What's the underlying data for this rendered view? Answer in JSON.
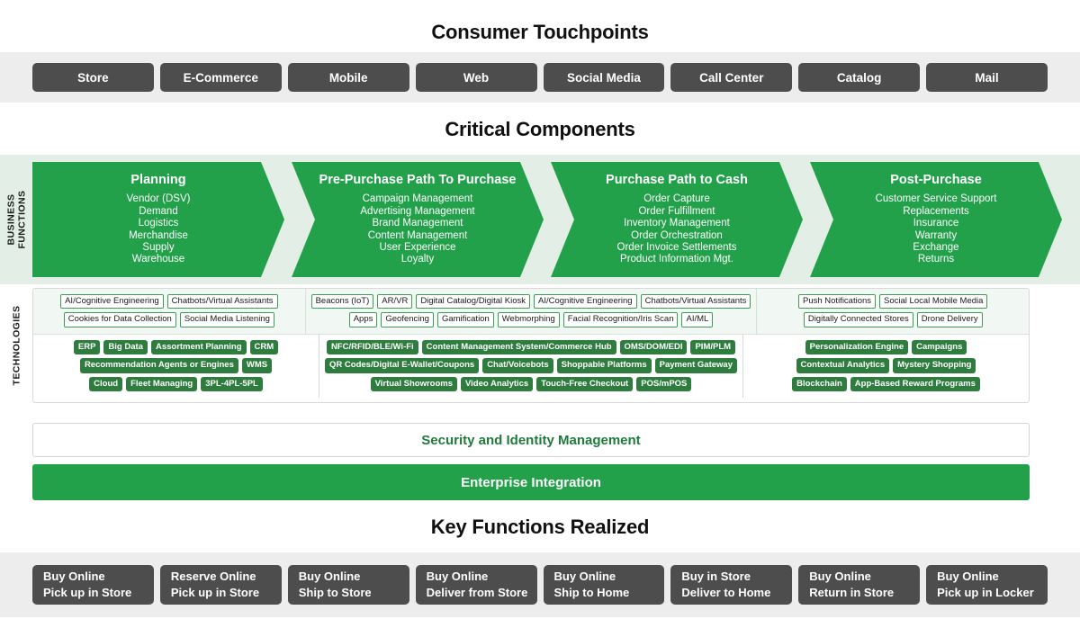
{
  "consumer_touchpoints": {
    "title": "Consumer Touchpoints",
    "items": [
      "Store",
      "E-Commerce",
      "Mobile",
      "Web",
      "Social Media",
      "Call Center",
      "Catalog",
      "Mail"
    ]
  },
  "critical_components": {
    "title": "Critical Components",
    "business_functions_label": "BUSINESS\nFUNCTIONS",
    "business_functions_label_line1": "BUSINESS",
    "business_functions_label_line2": "FUNCTIONS",
    "technologies_label": "TECHNOLOGIES",
    "stages": [
      {
        "title": "Planning",
        "items": [
          "Vendor (DSV)",
          "Demand",
          "Logistics",
          "Merchandise",
          "Supply",
          "Warehouse"
        ],
        "items_text": "Vendor (DSV)\nDemand\nLogistics\nMerchandise\nSupply\nWarehouse"
      },
      {
        "title": "Pre-Purchase Path To Purchase",
        "items": [
          "Campaign Management",
          "Advertising Management",
          "Brand Management",
          "Content Management",
          "User Experience",
          "Loyalty"
        ],
        "items_text": "Campaign Management\nAdvertising Management\nBrand Management\nContent Management\nUser Experience\nLoyalty"
      },
      {
        "title": "Purchase Path to Cash",
        "items": [
          "Order Capture",
          "Order Fulfillment",
          "Inventory Management",
          "Order Orchestration",
          "Order Invoice Settlements",
          "Product Information Mgt."
        ],
        "items_text": "Order Capture\nOrder Fulfillment\nInventory Management\nOrder Orchestration\nOrder Invoice Settlements\nProduct Information Mgt."
      },
      {
        "title": "Post-Purchase",
        "items": [
          "Customer Service Support",
          "Replacements",
          "Insurance",
          "Warranty",
          "Exchange",
          "Returns"
        ],
        "items_text": "Customer Service Support\nReplacements\nInsurance\nWarranty\nExchange\nReturns"
      }
    ],
    "technologies": {
      "outlined_columns": [
        {
          "lines": [
            [
              "AI/Cognitive Engineering",
              "Chatbots/Virtual Assistants"
            ],
            [
              "Cookies for Data Collection",
              "Social Media Listening"
            ]
          ]
        },
        {
          "lines": [
            [
              "Beacons (IoT)",
              "AR/VR",
              "Digital Catalog/Digital Kiosk",
              "AI/Cognitive Engineering",
              "Chatbots/Virtual Assistants"
            ],
            [
              "Apps",
              "Geofencing",
              "Gamification",
              "Webmorphing",
              "Facial Recognition/Iris Scan",
              "AI/ML"
            ]
          ]
        },
        {
          "lines": [
            [
              "Push Notifications",
              "Social Local Mobile Media"
            ],
            [
              "Digitally Connected Stores",
              "Drone Delivery"
            ]
          ]
        }
      ],
      "solid_columns": [
        {
          "lines": [
            [
              "ERP",
              "Big Data",
              "Assortment Planning",
              "CRM"
            ],
            [
              "Recommendation Agents or Engines",
              "WMS"
            ],
            [
              "Cloud",
              "Fleet Managing",
              "3PL-4PL-5PL"
            ]
          ]
        },
        {
          "lines": [
            [
              "NFC/RFID/BLE/Wi-Fi",
              "Content Management System/Commerce Hub",
              "OMS/DOM/EDI",
              "PIM/PLM"
            ],
            [
              "QR Codes/Digital E-Wallet/Coupons",
              "Chat/Voicebots",
              "Shoppable Platforms",
              "Payment Gateway"
            ],
            [
              "Virtual Showrooms",
              "Video Analytics",
              "Touch-Free Checkout",
              "POS/mPOS"
            ]
          ]
        },
        {
          "lines": [
            [
              "Personalization Engine",
              "Campaigns"
            ],
            [
              "Contextual Analytics",
              "Mystery Shopping"
            ],
            [
              "Blockchain",
              "App-Based Reward Programs"
            ]
          ]
        }
      ]
    },
    "security_bar": "Security and Identity Management",
    "enterprise_bar": "Enterprise Integration"
  },
  "key_functions": {
    "title": "Key Functions Realized",
    "items": [
      {
        "line1": "Buy Online",
        "line2": "Pick up in Store"
      },
      {
        "line1": "Reserve Online",
        "line2": "Pick up in Store"
      },
      {
        "line1": "Buy Online",
        "line2": "Ship to Store"
      },
      {
        "line1": "Buy Online",
        "line2": "Deliver from Store"
      },
      {
        "line1": "Buy Online",
        "line2": "Ship to Home"
      },
      {
        "line1": "Buy in Store",
        "line2": "Deliver to Home"
      },
      {
        "line1": "Buy Online",
        "line2": "Return in Store"
      },
      {
        "line1": "Buy Online",
        "line2": "Pick up in Locker"
      }
    ]
  },
  "colors": {
    "green": "#22a04a",
    "green_dark": "#2e7d3e",
    "green_tint": "#e3efe6",
    "grey_band": "#ededed",
    "grey_pill": "#4d4d4d"
  }
}
